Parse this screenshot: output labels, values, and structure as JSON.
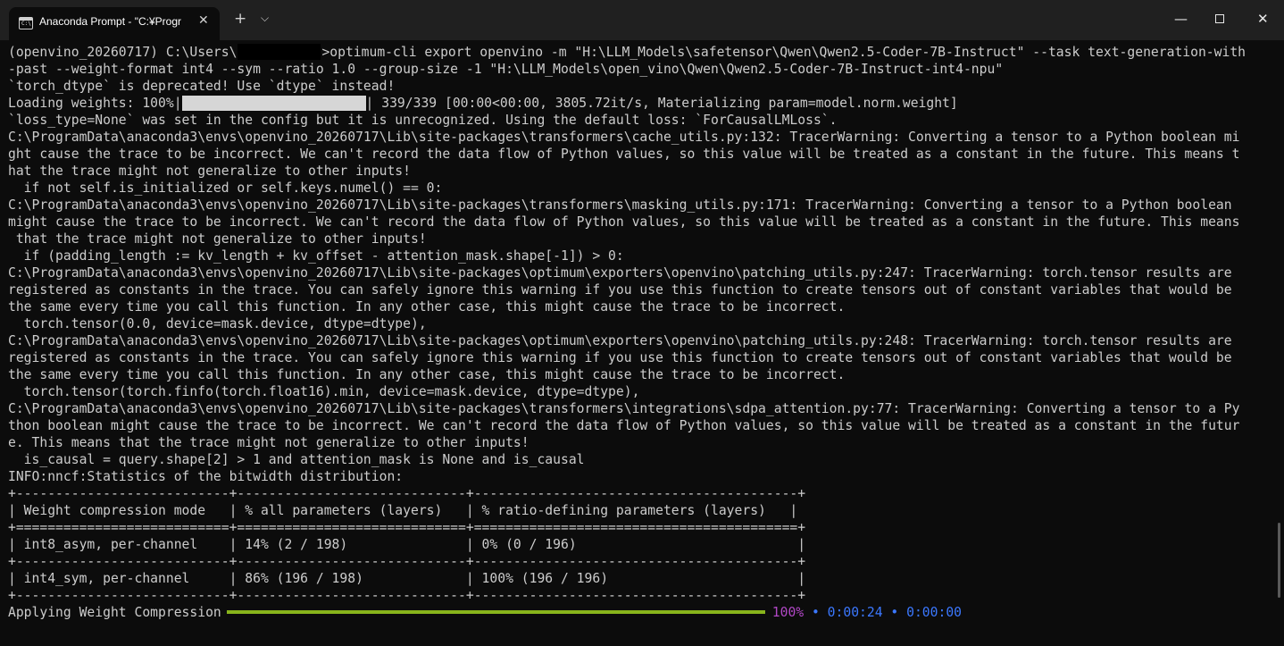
{
  "window": {
    "tab_title": "Anaconda Prompt - \"C:¥Progr",
    "tab_icon_text": "C:\\",
    "close_glyph": "✕",
    "new_tab_glyph": "+",
    "dropdown_glyph": "⌵",
    "minimize_glyph": "—",
    "window_close_glyph": "✕"
  },
  "terminal": {
    "prompt_prefix": "(openvino_20260717) C:\\Users\\",
    "prompt_suffix": ">optimum-cli export openvino -m \"H:\\LLM_Models\\safetensor\\Qwen\\Qwen2.5-Coder-7B-Instruct\" --task text-generation-with",
    "line1": "-past --weight-format int4 --sym --ratio 1.0 --group-size -1 \"H:\\LLM_Models\\open_vino\\Qwen\\Qwen2.5-Coder-7B-Instruct-int4-npu\"",
    "line2": "`torch_dtype` is deprecated! Use `dtype` instead!",
    "loading_prefix": "Loading weights: 100%|",
    "loading_suffix": "| 339/339 [00:00<00:00, 3805.72it/s, Materializing param=model.norm.weight]",
    "lines": [
      "`loss_type=None` was set in the config but it is unrecognized. Using the default loss: `ForCausalLMLoss`.",
      "C:\\ProgramData\\anaconda3\\envs\\openvino_20260717\\Lib\\site-packages\\transformers\\cache_utils.py:132: TracerWarning: Converting a tensor to a Python boolean mi",
      "ght cause the trace to be incorrect. We can't record the data flow of Python values, so this value will be treated as a constant in the future. This means t",
      "hat the trace might not generalize to other inputs!",
      "  if not self.is_initialized or self.keys.numel() == 0:",
      "C:\\ProgramData\\anaconda3\\envs\\openvino_20260717\\Lib\\site-packages\\transformers\\masking_utils.py:171: TracerWarning: Converting a tensor to a Python boolean",
      "might cause the trace to be incorrect. We can't record the data flow of Python values, so this value will be treated as a constant in the future. This means",
      " that the trace might not generalize to other inputs!",
      "  if (padding_length := kv_length + kv_offset - attention_mask.shape[-1]) > 0:",
      "C:\\ProgramData\\anaconda3\\envs\\openvino_20260717\\Lib\\site-packages\\optimum\\exporters\\openvino\\patching_utils.py:247: TracerWarning: torch.tensor results are",
      "registered as constants in the trace. You can safely ignore this warning if you use this function to create tensors out of constant variables that would be",
      "the same every time you call this function. In any other case, this might cause the trace to be incorrect.",
      "  torch.tensor(0.0, device=mask.device, dtype=dtype),",
      "C:\\ProgramData\\anaconda3\\envs\\openvino_20260717\\Lib\\site-packages\\optimum\\exporters\\openvino\\patching_utils.py:248: TracerWarning: torch.tensor results are",
      "registered as constants in the trace. You can safely ignore this warning if you use this function to create tensors out of constant variables that would be",
      "the same every time you call this function. In any other case, this might cause the trace to be incorrect.",
      "  torch.tensor(torch.finfo(torch.float16).min, device=mask.device, dtype=dtype),",
      "C:\\ProgramData\\anaconda3\\envs\\openvino_20260717\\Lib\\site-packages\\transformers\\integrations\\sdpa_attention.py:77: TracerWarning: Converting a tensor to a Py",
      "thon boolean might cause the trace to be incorrect. We can't record the data flow of Python values, so this value will be treated as a constant in the futur",
      "e. This means that the trace might not generalize to other inputs!",
      "  is_causal = query.shape[2] > 1 and attention_mask is None and is_causal",
      "INFO:nncf:Statistics of the bitwidth distribution:",
      "+---------------------------+-----------------------------+-----------------------------------------+",
      "| Weight compression mode   | % all parameters (layers)   | % ratio-defining parameters (layers)   |",
      "+===========================+=============================+=========================================+",
      "| int8_asym, per-channel    | 14% (2 / 198)               | 0% (0 / 196)                            |",
      "+---------------------------+-----------------------------+-----------------------------------------+",
      "| int4_sym, per-channel     | 86% (196 / 198)             | 100% (196 / 196)                        |",
      "+---------------------------+-----------------------------+-----------------------------------------+"
    ],
    "progress": {
      "label": "Applying Weight Compression",
      "fraction": 1.0,
      "percent": "100%",
      "bullet": "•",
      "elapsed": "0:00:24",
      "remaining": "0:00:00"
    }
  },
  "colors": {
    "background": "#0c0c0c",
    "text": "#cccccc",
    "progress_bar": "#88b41c",
    "percent": "#b148c6",
    "time": "#3b78ff"
  }
}
